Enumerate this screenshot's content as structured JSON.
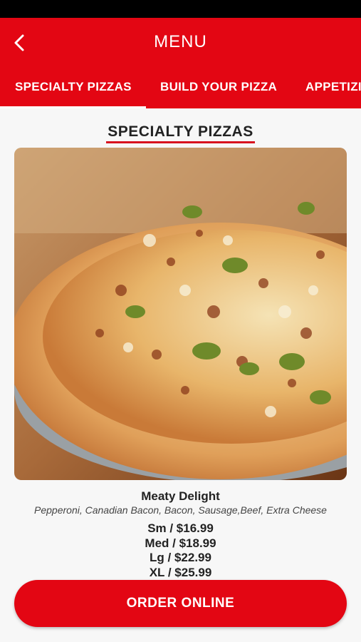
{
  "header": {
    "title": "MENU"
  },
  "tabs": [
    {
      "label": "SPECIALTY PIZZAS",
      "active": true
    },
    {
      "label": "BUILD YOUR PIZZA",
      "active": false
    },
    {
      "label": "APPETIZI",
      "active": false
    }
  ],
  "section": {
    "title": "SPECIALTY PIZZAS"
  },
  "item": {
    "name": "Meaty Delight",
    "description": "Pepperoni, Canadian Bacon, Bacon, Sausage,Beef, Extra Cheese",
    "prices": [
      "Sm / $16.99",
      "Med / $18.99",
      "Lg / $22.99",
      "XL / $25.99"
    ]
  },
  "order_button": {
    "label": "ORDER ONLINE"
  },
  "colors": {
    "brand_red": "#e30613",
    "underline_red": "#d8121f",
    "status_bar": "#000000"
  },
  "icons": {
    "back": "chevron-left-icon"
  }
}
